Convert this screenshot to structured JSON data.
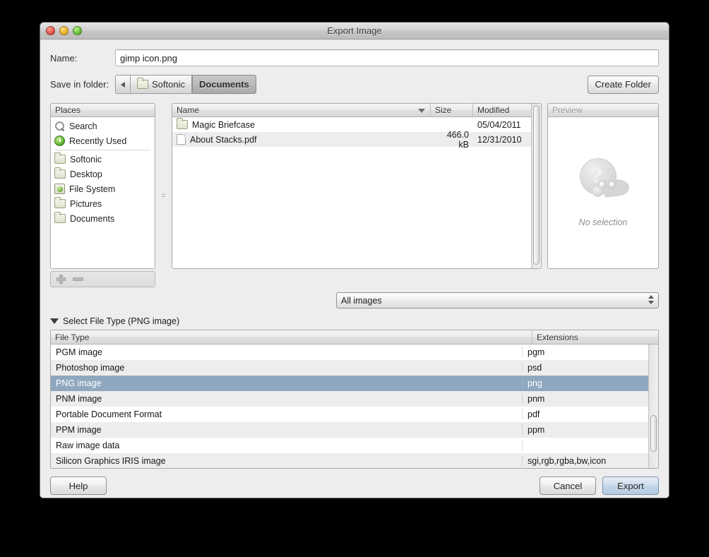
{
  "window": {
    "title": "Export Image",
    "traffic_lights": [
      "close",
      "minimize",
      "zoom"
    ]
  },
  "form": {
    "name_label": "Name:",
    "name_value": "gimp icon.png",
    "name_placeholder": "",
    "folder_label": "Save in folder:",
    "create_folder_label": "Create Folder"
  },
  "pathbar": {
    "back_icon": "triangle-left-icon",
    "crumbs": [
      {
        "label": "Softonic",
        "active": false
      },
      {
        "label": "Documents",
        "active": true
      }
    ]
  },
  "places": {
    "header": "Places",
    "items": [
      {
        "label": "Search",
        "icon": "search-icon"
      },
      {
        "label": "Recently Used",
        "icon": "clock-icon"
      },
      {
        "label": "Softonic",
        "icon": "folder-icon"
      },
      {
        "label": "Desktop",
        "icon": "folder-icon"
      },
      {
        "label": "File System",
        "icon": "hard-drive-icon"
      },
      {
        "label": "Pictures",
        "icon": "folder-icon"
      },
      {
        "label": "Documents",
        "icon": "folder-icon"
      }
    ],
    "add_icon": "plus-icon",
    "remove_icon": "minus-icon"
  },
  "filelist": {
    "columns": [
      "Name",
      "Size",
      "Modified"
    ],
    "sort_icon": "sort-descending-icon",
    "rows": [
      {
        "name": "Magic Briefcase",
        "size": "",
        "modified": "05/04/2011",
        "icon": "folder-icon"
      },
      {
        "name": "About Stacks.pdf",
        "size": "466.0 kB",
        "modified": "12/31/2010",
        "icon": "document-icon"
      }
    ]
  },
  "preview": {
    "header": "Preview",
    "empty_text": "No selection",
    "icon": "wilber-question-icon"
  },
  "filter": {
    "value": "All images",
    "spinner_icon": "spinner-arrows-icon"
  },
  "file_type_section": {
    "disclosure_icon": "triangle-down-icon",
    "label": "Select File Type (PNG image)",
    "columns": [
      "File Type",
      "Extensions"
    ],
    "rows": [
      {
        "type": "PGM image",
        "ext": "pgm",
        "selected": false
      },
      {
        "type": "Photoshop image",
        "ext": "psd",
        "selected": false
      },
      {
        "type": "PNG image",
        "ext": "png",
        "selected": true
      },
      {
        "type": "PNM image",
        "ext": "pnm",
        "selected": false
      },
      {
        "type": "Portable Document Format",
        "ext": "pdf",
        "selected": false
      },
      {
        "type": "PPM image",
        "ext": "ppm",
        "selected": false
      },
      {
        "type": "Raw image data",
        "ext": "",
        "selected": false
      },
      {
        "type": "Silicon Graphics IRIS image",
        "ext": "sgi,rgb,rgba,bw,icon",
        "selected": false
      }
    ],
    "selection_color": "#8fa8bf"
  },
  "footer": {
    "help_label": "Help",
    "cancel_label": "Cancel",
    "export_label": "Export"
  }
}
